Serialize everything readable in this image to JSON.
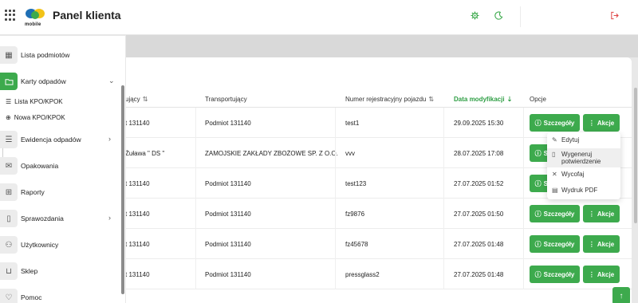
{
  "header": {
    "title": "Panel klienta",
    "logo_text": "mobile",
    "icons": [
      "grid-menu-icon",
      "settings-gear-icon",
      "moon-icon",
      "logout-icon"
    ]
  },
  "colors": {
    "accent": "#3daa4d",
    "sort_active": "#2e9e44",
    "logout": "#e04444"
  },
  "sidebar": {
    "items": [
      {
        "label": "Lista podmiotów",
        "icon": "building-icon"
      },
      {
        "label": "Karty odpadów",
        "icon": "folder-icon",
        "active": true
      },
      {
        "label": "Ewidencja odpadów",
        "icon": "list-icon"
      },
      {
        "label": "Opakowania",
        "icon": "box-icon"
      },
      {
        "label": "Raporty",
        "icon": "table-icon"
      },
      {
        "label": "Sprawozdania",
        "icon": "document-icon"
      },
      {
        "label": "Użytkownicy",
        "icon": "users-icon"
      },
      {
        "label": "Sklep",
        "icon": "cart-icon"
      },
      {
        "label": "Pomoc",
        "icon": "heart-icon"
      }
    ],
    "sub_items": [
      {
        "label": "Lista KPO/KPOK",
        "icon": "list-icon"
      },
      {
        "label": "Nowa KPO/KPOK",
        "icon": "plus-circle-icon"
      }
    ]
  },
  "table": {
    "columns": {
      "col1": "ujący",
      "transport": "Transportujący",
      "plate": "Numer rejestracyjny pojazdu",
      "date": "Data modyfikacji",
      "options": "Opcje"
    },
    "rows": [
      {
        "col1": "t 131140",
        "transport": "Podmiot 131140",
        "plate": "test1",
        "date": "29.09.2025 15:30"
      },
      {
        "col1": "Żuława \" DS \"",
        "transport": "ZAMOJSKIE ZAKŁADY ZBOŻOWE SP. Z O.O.",
        "plate": "vvv",
        "date": "28.07.2025 17:08"
      },
      {
        "col1": "t 131140",
        "transport": "Podmiot 131140",
        "plate": "test123",
        "date": "27.07.2025 01:52"
      },
      {
        "col1": "t 131140",
        "transport": "Podmiot 131140",
        "plate": "fz9876",
        "date": "27.07.2025 01:50"
      },
      {
        "col1": "t 131140",
        "transport": "Podmiot 131140",
        "plate": "fz45678",
        "date": "27.07.2025 01:48"
      },
      {
        "col1": "t 131140",
        "transport": "Podmiot 131140",
        "plate": "pressglass2",
        "date": "27.07.2025 01:48"
      }
    ],
    "details_label": "Szczegóły",
    "actions_label": "Akcje"
  },
  "dropdown": {
    "items": [
      {
        "label": "Edytuj",
        "icon": "pencil-icon"
      },
      {
        "label": "Wygeneruj\npotwierdzenie",
        "icon": "file-icon"
      },
      {
        "label": "Wycofaj",
        "icon": "x-icon"
      },
      {
        "label": "Wydruk PDF",
        "icon": "pdf-icon"
      }
    ]
  }
}
